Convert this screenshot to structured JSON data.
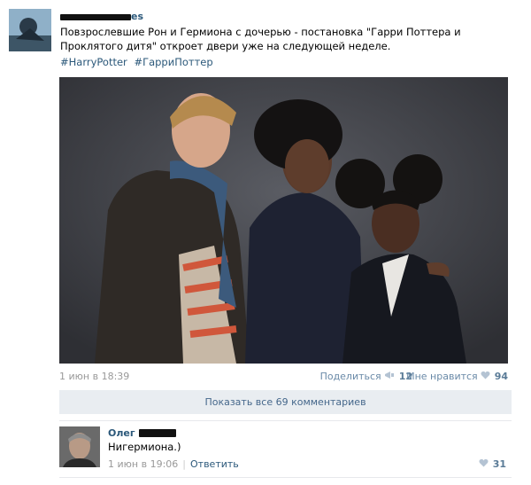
{
  "post": {
    "author_suffix": "es",
    "text": "Повзрослевшие Рон и Гермиона с дочерью - постановка \"Гарри Поттера и Проклятого дитя\" откроет двери уже на следующей неделе.",
    "hashtags": [
      "#HarryPotter",
      "#ГарриПоттер"
    ],
    "date": "1 июн в 18:39",
    "share_label": "Поделиться",
    "share_count": "12",
    "like_label": "Мне нравится",
    "like_count": "94"
  },
  "comments": {
    "show_all_label": "Показать все 69 комментариев",
    "items": [
      {
        "author": "Олег",
        "text": "Нигермиона.)",
        "date": "1 июн в 19:06",
        "reply_label": "Ответить",
        "like_count": "31"
      }
    ]
  },
  "colors": {
    "link": "#2b587a",
    "meta": "#999999",
    "button_bg": "#e9edf1"
  }
}
